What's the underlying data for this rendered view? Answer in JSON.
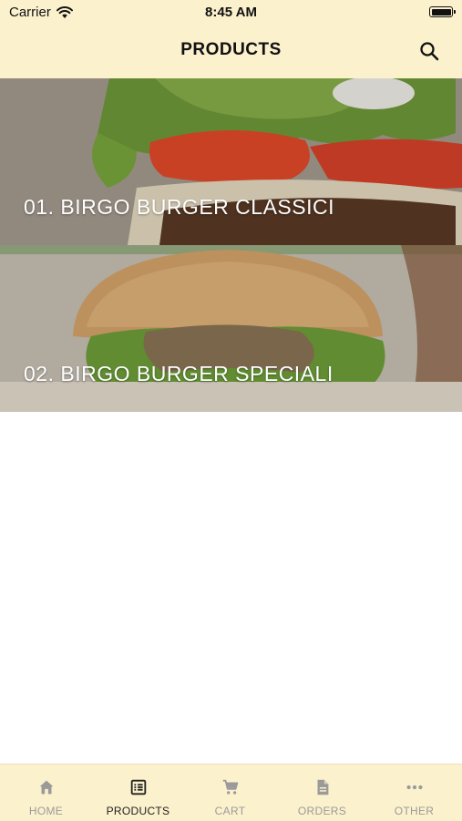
{
  "status_bar": {
    "carrier": "Carrier",
    "time": "8:45 AM"
  },
  "header": {
    "title": "PRODUCTS"
  },
  "categories": [
    {
      "label": "01. BIRGO BURGER CLASSICI"
    },
    {
      "label": "02. BIRGO BURGER SPECIALI"
    }
  ],
  "tabbar": {
    "tabs": [
      {
        "label": "HOME",
        "icon": "home-icon"
      },
      {
        "label": "PRODUCTS",
        "icon": "list-icon",
        "active": true
      },
      {
        "label": "CART",
        "icon": "cart-icon"
      },
      {
        "label": "ORDERS",
        "icon": "document-icon"
      },
      {
        "label": "OTHER",
        "icon": "more-icon"
      }
    ]
  },
  "colors": {
    "header_bg": "#fcf1cd",
    "active_tab": "#222222",
    "inactive_tab": "#9a9a9a"
  }
}
